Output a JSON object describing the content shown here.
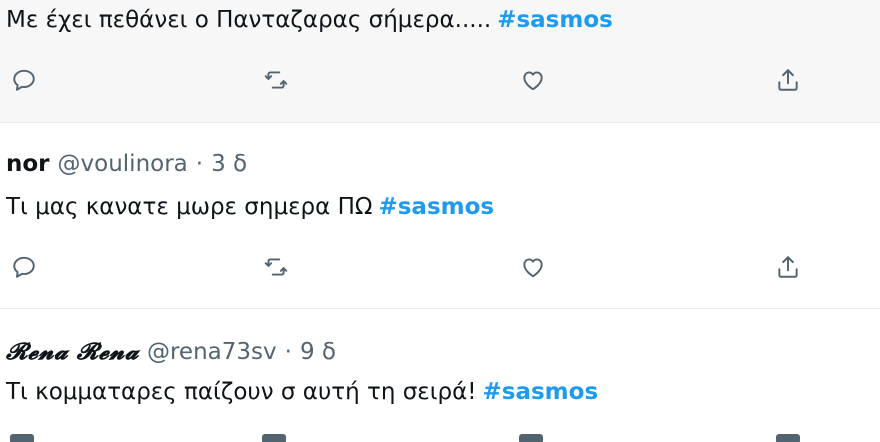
{
  "tweets": [
    {
      "name": "",
      "handle": "",
      "time": "",
      "text": "Με έχει πεθάνει ο Πανταζαρας σήμερα.....",
      "hashtag": "#sasmos"
    },
    {
      "name": "nor",
      "handle": "@voulinora",
      "separator": "·",
      "time": "3 δ",
      "text": "Τι μας κανατε μωρε σημερα ΠΩ",
      "hashtag": "#sasmos"
    },
    {
      "name": "𝓡𝓮𝓷𝓪 𝓡𝓮𝓷𝓪",
      "handle": "@rena73sv",
      "separator": "·",
      "time": "9 δ",
      "text": "Τι κομματαρες παίζουν σ αυτή τη σειρά!",
      "hashtag": "#sasmos"
    }
  ],
  "actions": [
    "reply-icon",
    "retweet-icon",
    "like-icon",
    "share-icon"
  ],
  "colors": {
    "hashtag": "#1d9bf0",
    "secondary_text": "#536471",
    "primary_text": "#0f1419",
    "shaded_bg": "#f7f7f7",
    "divider": "#e6ecf0"
  }
}
